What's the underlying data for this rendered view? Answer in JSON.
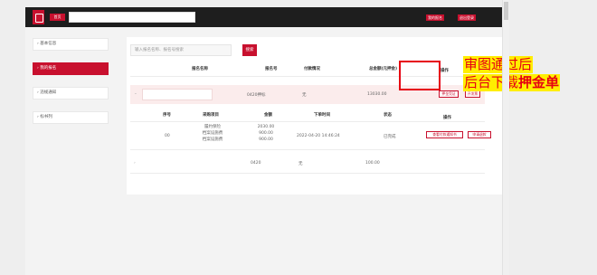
{
  "header": {
    "home_label": "首页",
    "link1": "我的报名",
    "link2": "退出登录"
  },
  "sidebar": {
    "items": [
      {
        "label": "基本信息",
        "active": false
      },
      {
        "label": "我的报名",
        "active": true
      },
      {
        "label": "违规通知",
        "active": false
      },
      {
        "label": "标书列",
        "active": false
      }
    ]
  },
  "search": {
    "placeholder": "输入报名名称、报名号搜索",
    "button": "搜索"
  },
  "table": {
    "headers": [
      "报名名称",
      "报名号",
      "付款情况",
      "总金额(元押金)",
      "操作"
    ],
    "row1": {
      "number": "0420押标",
      "paid": "无",
      "amount": "13030.00",
      "btn_deposit": "押金凭证",
      "btn_extra": "开发票"
    },
    "subheaders": [
      "序号",
      "采购项目",
      "金额",
      "下单时间",
      "状态",
      "操作"
    ],
    "sub": {
      "index": "00",
      "items": [
        "履约保险",
        "档案设施费",
        "档案设施费"
      ],
      "amounts": [
        "2030.00",
        "900.00",
        "900.00"
      ],
      "time": "2022-04-20 14:46:24",
      "status": "已完成",
      "btn_view": "查看付款通知书",
      "btn_apply": "申请退款"
    },
    "row2": {
      "number": "0420",
      "paid": "无",
      "amount": "100.00"
    }
  },
  "annotation": {
    "line1": "审图通过后",
    "line2_pre": "后台下载",
    "line2_bold": "押金单"
  }
}
